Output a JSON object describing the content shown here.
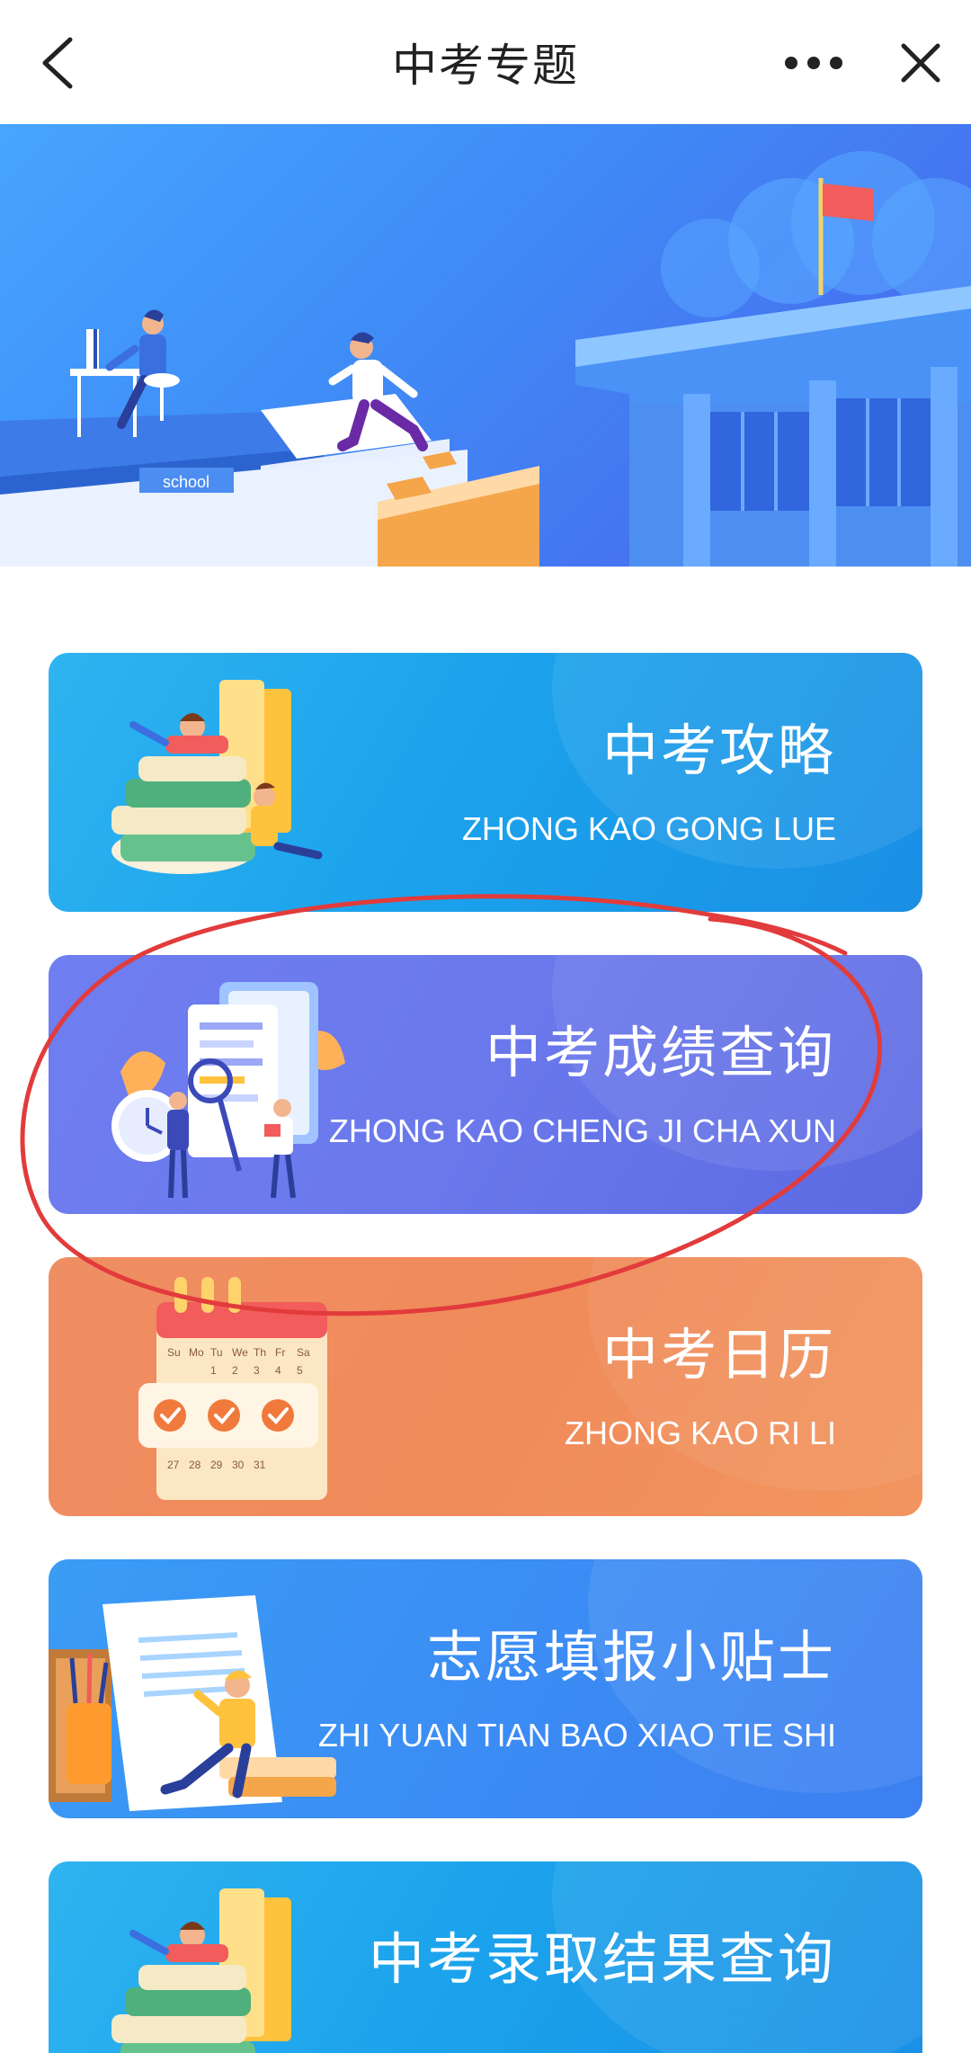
{
  "header": {
    "title": "中考专题",
    "back_icon": "chevron-left-icon",
    "more_icon": "more-dots-icon",
    "close_icon": "close-icon"
  },
  "banner": {
    "sign_text": "school"
  },
  "cards": [
    {
      "title": "中考攻略",
      "subtitle": "ZHONG KAO GONG LUE",
      "icon": "books-reading-illustration",
      "color": "#1ba3ec"
    },
    {
      "title": "中考成绩查询",
      "subtitle": "ZHONG KAO CHENG JI CHA XUN",
      "icon": "score-report-illustration",
      "color": "#6a78ec"
    },
    {
      "title": "中考日历",
      "subtitle": "ZHONG KAO RI LI",
      "icon": "calendar-illustration",
      "color": "#f08b5a"
    },
    {
      "title": "志愿填报小贴士",
      "subtitle": "ZHI YUAN TIAN BAO XIAO TIE SHI",
      "icon": "application-tips-illustration",
      "color": "#3b8df4"
    },
    {
      "title": "中考录取结果查询",
      "subtitle": "",
      "icon": "books-reading-illustration",
      "color": "#1ba3ec"
    }
  ],
  "calendar": {
    "weekdays": [
      "Su",
      "Mo",
      "Tu",
      "We",
      "Th",
      "Fr",
      "Sa"
    ],
    "row1": [
      "1",
      "2",
      "3",
      "4",
      "5"
    ],
    "row3": [
      "27",
      "28",
      "29",
      "30",
      "31"
    ]
  },
  "colors": {
    "annotation_circle": "#e23b3b"
  }
}
